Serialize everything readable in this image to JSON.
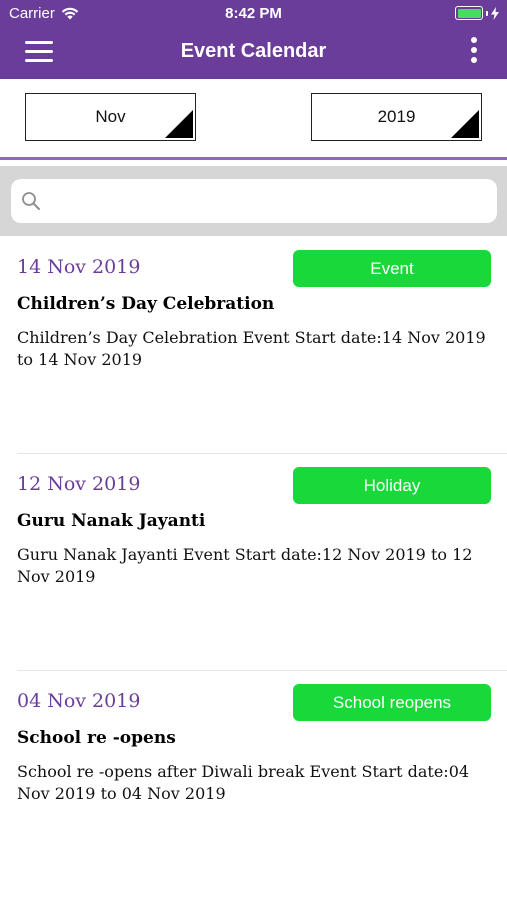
{
  "status_bar": {
    "carrier": "Carrier",
    "time": "8:42 PM",
    "battery_level": 1.0
  },
  "navbar": {
    "title": "Event Calendar",
    "menu_icon": "hamburger-menu-icon",
    "more_icon": "vertical-ellipsis-icon"
  },
  "filters": {
    "month": "Nov",
    "year": "2019"
  },
  "search": {
    "placeholder": "",
    "icon": "search-icon"
  },
  "colors": {
    "primary": "#6a3d9a",
    "badge": "#18d83a"
  },
  "events": [
    {
      "date": "14 Nov 2019",
      "type": "Event",
      "title": "Children’s Day Celebration",
      "description": "Children’s Day Celebration Event Start date:14 Nov 2019 to 14 Nov 2019"
    },
    {
      "date": "12 Nov 2019",
      "type": "Holiday",
      "title": "Guru Nanak Jayanti",
      "description": "Guru Nanak Jayanti Event Start date:12 Nov 2019 to 12 Nov 2019"
    },
    {
      "date": "04 Nov 2019",
      "type": "School reopens",
      "title": "School re -opens",
      "description": "School re -opens after Diwali break Event Start date:04 Nov 2019 to 04 Nov 2019"
    }
  ]
}
